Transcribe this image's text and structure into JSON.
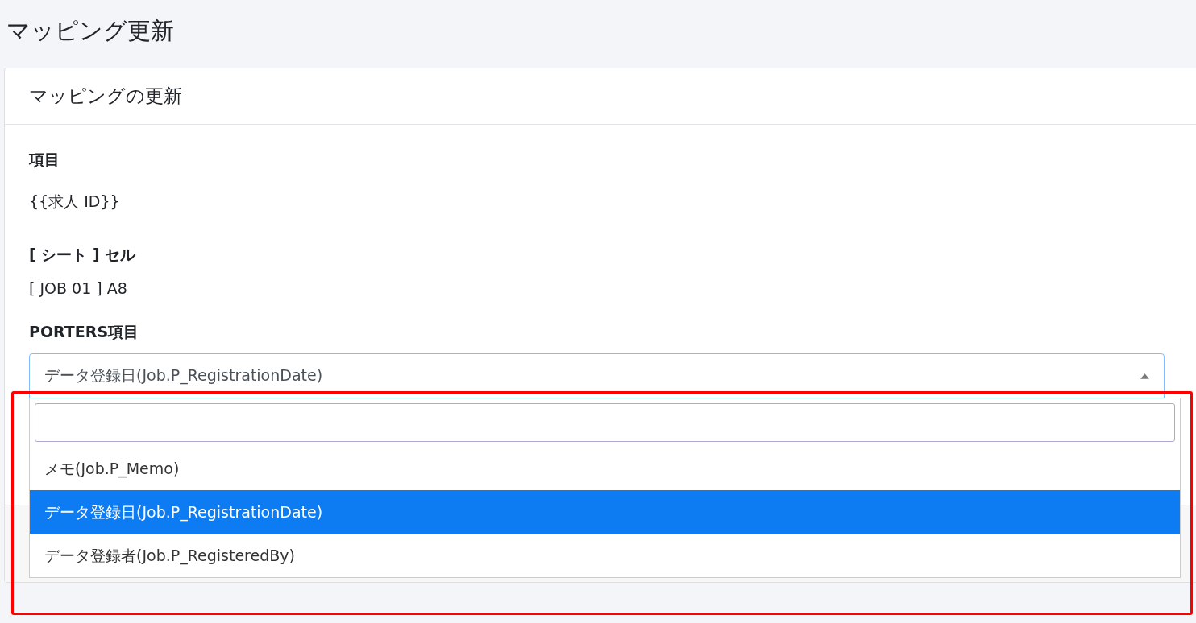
{
  "page_title": "マッピング更新",
  "card": {
    "title": "マッピングの更新",
    "fields": [
      {
        "label": "項目",
        "value": "{{求人 ID}}"
      },
      {
        "label": "[ シート ] セル",
        "value": "[ JOB 01 ] A8"
      }
    ],
    "select": {
      "label": "PORTERS項目",
      "value": "データ登録日(Job.P_RegistrationDate)",
      "expanded": true,
      "options": [
        {
          "label": "メモ(Job.P_Memo)",
          "selected": false
        },
        {
          "label": "データ登録日(Job.P_RegistrationDate)",
          "selected": true
        },
        {
          "label": "データ登録者(Job.P_RegisteredBy)",
          "selected": false
        }
      ]
    }
  }
}
